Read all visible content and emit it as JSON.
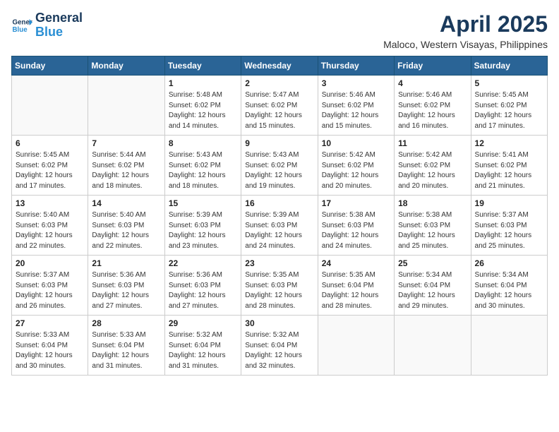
{
  "app": {
    "name": "GeneralBlue",
    "logo_alt": "General Blue logo"
  },
  "title": {
    "month_year": "April 2025",
    "location": "Maloco, Western Visayas, Philippines"
  },
  "weekdays": [
    "Sunday",
    "Monday",
    "Tuesday",
    "Wednesday",
    "Thursday",
    "Friday",
    "Saturday"
  ],
  "weeks": [
    [
      {
        "day": "",
        "info": ""
      },
      {
        "day": "",
        "info": ""
      },
      {
        "day": "1",
        "info": "Sunrise: 5:48 AM\nSunset: 6:02 PM\nDaylight: 12 hours and 14 minutes."
      },
      {
        "day": "2",
        "info": "Sunrise: 5:47 AM\nSunset: 6:02 PM\nDaylight: 12 hours and 15 minutes."
      },
      {
        "day": "3",
        "info": "Sunrise: 5:46 AM\nSunset: 6:02 PM\nDaylight: 12 hours and 15 minutes."
      },
      {
        "day": "4",
        "info": "Sunrise: 5:46 AM\nSunset: 6:02 PM\nDaylight: 12 hours and 16 minutes."
      },
      {
        "day": "5",
        "info": "Sunrise: 5:45 AM\nSunset: 6:02 PM\nDaylight: 12 hours and 17 minutes."
      }
    ],
    [
      {
        "day": "6",
        "info": "Sunrise: 5:45 AM\nSunset: 6:02 PM\nDaylight: 12 hours and 17 minutes."
      },
      {
        "day": "7",
        "info": "Sunrise: 5:44 AM\nSunset: 6:02 PM\nDaylight: 12 hours and 18 minutes."
      },
      {
        "day": "8",
        "info": "Sunrise: 5:43 AM\nSunset: 6:02 PM\nDaylight: 12 hours and 18 minutes."
      },
      {
        "day": "9",
        "info": "Sunrise: 5:43 AM\nSunset: 6:02 PM\nDaylight: 12 hours and 19 minutes."
      },
      {
        "day": "10",
        "info": "Sunrise: 5:42 AM\nSunset: 6:02 PM\nDaylight: 12 hours and 20 minutes."
      },
      {
        "day": "11",
        "info": "Sunrise: 5:42 AM\nSunset: 6:02 PM\nDaylight: 12 hours and 20 minutes."
      },
      {
        "day": "12",
        "info": "Sunrise: 5:41 AM\nSunset: 6:02 PM\nDaylight: 12 hours and 21 minutes."
      }
    ],
    [
      {
        "day": "13",
        "info": "Sunrise: 5:40 AM\nSunset: 6:03 PM\nDaylight: 12 hours and 22 minutes."
      },
      {
        "day": "14",
        "info": "Sunrise: 5:40 AM\nSunset: 6:03 PM\nDaylight: 12 hours and 22 minutes."
      },
      {
        "day": "15",
        "info": "Sunrise: 5:39 AM\nSunset: 6:03 PM\nDaylight: 12 hours and 23 minutes."
      },
      {
        "day": "16",
        "info": "Sunrise: 5:39 AM\nSunset: 6:03 PM\nDaylight: 12 hours and 24 minutes."
      },
      {
        "day": "17",
        "info": "Sunrise: 5:38 AM\nSunset: 6:03 PM\nDaylight: 12 hours and 24 minutes."
      },
      {
        "day": "18",
        "info": "Sunrise: 5:38 AM\nSunset: 6:03 PM\nDaylight: 12 hours and 25 minutes."
      },
      {
        "day": "19",
        "info": "Sunrise: 5:37 AM\nSunset: 6:03 PM\nDaylight: 12 hours and 25 minutes."
      }
    ],
    [
      {
        "day": "20",
        "info": "Sunrise: 5:37 AM\nSunset: 6:03 PM\nDaylight: 12 hours and 26 minutes."
      },
      {
        "day": "21",
        "info": "Sunrise: 5:36 AM\nSunset: 6:03 PM\nDaylight: 12 hours and 27 minutes."
      },
      {
        "day": "22",
        "info": "Sunrise: 5:36 AM\nSunset: 6:03 PM\nDaylight: 12 hours and 27 minutes."
      },
      {
        "day": "23",
        "info": "Sunrise: 5:35 AM\nSunset: 6:03 PM\nDaylight: 12 hours and 28 minutes."
      },
      {
        "day": "24",
        "info": "Sunrise: 5:35 AM\nSunset: 6:04 PM\nDaylight: 12 hours and 28 minutes."
      },
      {
        "day": "25",
        "info": "Sunrise: 5:34 AM\nSunset: 6:04 PM\nDaylight: 12 hours and 29 minutes."
      },
      {
        "day": "26",
        "info": "Sunrise: 5:34 AM\nSunset: 6:04 PM\nDaylight: 12 hours and 30 minutes."
      }
    ],
    [
      {
        "day": "27",
        "info": "Sunrise: 5:33 AM\nSunset: 6:04 PM\nDaylight: 12 hours and 30 minutes."
      },
      {
        "day": "28",
        "info": "Sunrise: 5:33 AM\nSunset: 6:04 PM\nDaylight: 12 hours and 31 minutes."
      },
      {
        "day": "29",
        "info": "Sunrise: 5:32 AM\nSunset: 6:04 PM\nDaylight: 12 hours and 31 minutes."
      },
      {
        "day": "30",
        "info": "Sunrise: 5:32 AM\nSunset: 6:04 PM\nDaylight: 12 hours and 32 minutes."
      },
      {
        "day": "",
        "info": ""
      },
      {
        "day": "",
        "info": ""
      },
      {
        "day": "",
        "info": ""
      }
    ]
  ]
}
